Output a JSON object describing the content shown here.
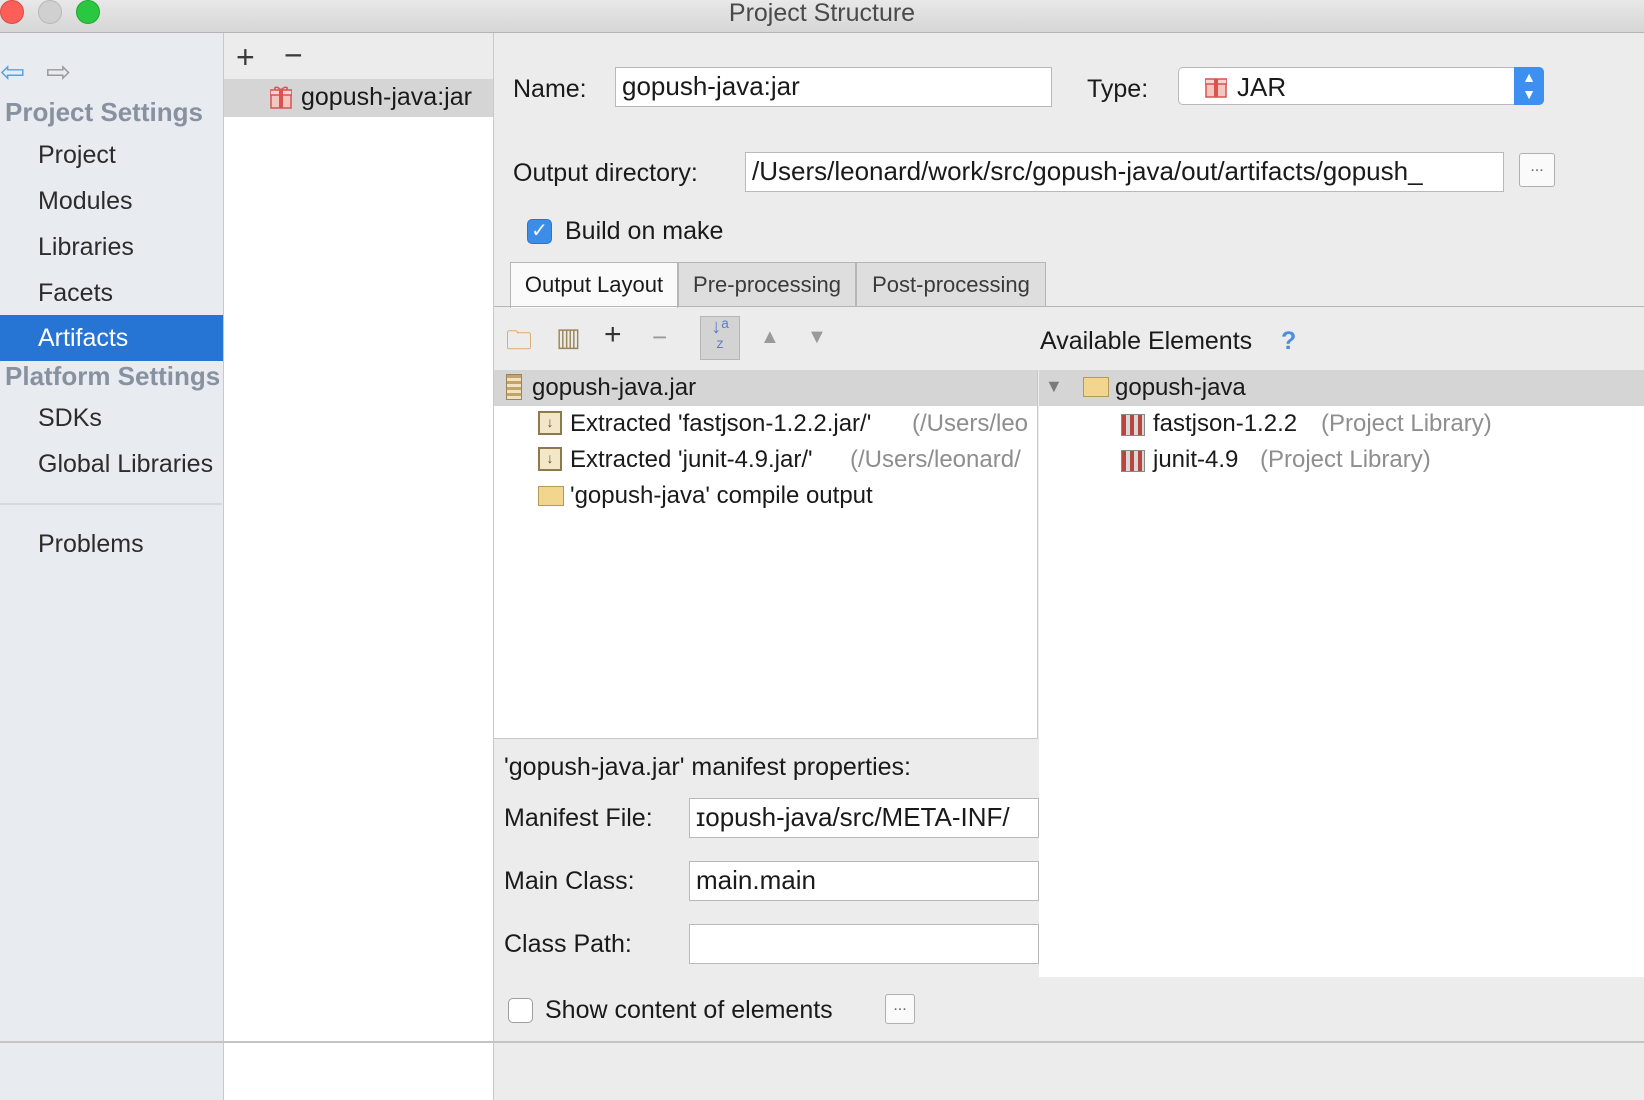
{
  "window": {
    "title": "Project Structure"
  },
  "nav": {
    "project_settings_header": "Project Settings",
    "platform_settings_header": "Platform Settings",
    "items": [
      {
        "label": "Project"
      },
      {
        "label": "Modules"
      },
      {
        "label": "Libraries"
      },
      {
        "label": "Facets"
      },
      {
        "label": "Artifacts",
        "selected": true
      },
      {
        "label": "SDKs"
      },
      {
        "label": "Global Libraries"
      },
      {
        "label": "Problems"
      }
    ]
  },
  "artifact_list": {
    "add_label": "+",
    "remove_label": "−",
    "items": [
      {
        "label": "gopush-java:jar",
        "icon": "jar-gift-icon"
      }
    ]
  },
  "form": {
    "name_label": "Name:",
    "name_value": "gopush-java:jar",
    "type_label": "Type:",
    "type_value": "JAR",
    "output_dir_label": "Output directory:",
    "output_dir_value": "/Users/leonard/work/src/gopush-java/out/artifacts/gopush_",
    "browse_label": "...",
    "build_on_make_label": "Build on make",
    "build_on_make_checked": true
  },
  "tabs": [
    {
      "label": "Output Layout",
      "active": true
    },
    {
      "label": "Pre-processing"
    },
    {
      "label": "Post-processing"
    }
  ],
  "layout_tree": {
    "root": "gopush-java.jar",
    "children": [
      {
        "label": "Extracted 'fastjson-1.2.2.jar/'",
        "path": "(/Users/leo"
      },
      {
        "label": "Extracted 'junit-4.9.jar/'",
        "path": "(/Users/leonard/"
      },
      {
        "label": "'gopush-java' compile output",
        "path": ""
      }
    ]
  },
  "available": {
    "header": "Available Elements",
    "help": "?",
    "module": "gopush-java",
    "libraries": [
      {
        "name": "fastjson-1.2.2",
        "kind": "(Project Library)"
      },
      {
        "name": "junit-4.9",
        "kind": "(Project Library)"
      }
    ]
  },
  "manifest": {
    "title": "'gopush-java.jar' manifest properties:",
    "manifest_file_label": "Manifest File:",
    "manifest_file_value": "ɪopush-java/src/META-INF/",
    "main_class_label": "Main Class:",
    "main_class_value": "main.main",
    "class_path_label": "Class Path:",
    "class_path_value": ""
  },
  "footer": {
    "show_content_label": "Show content of elements",
    "show_content_checked": false,
    "more_label": "..."
  },
  "colors": {
    "accent": "#2675d5",
    "checkbox": "#3b8de8"
  }
}
